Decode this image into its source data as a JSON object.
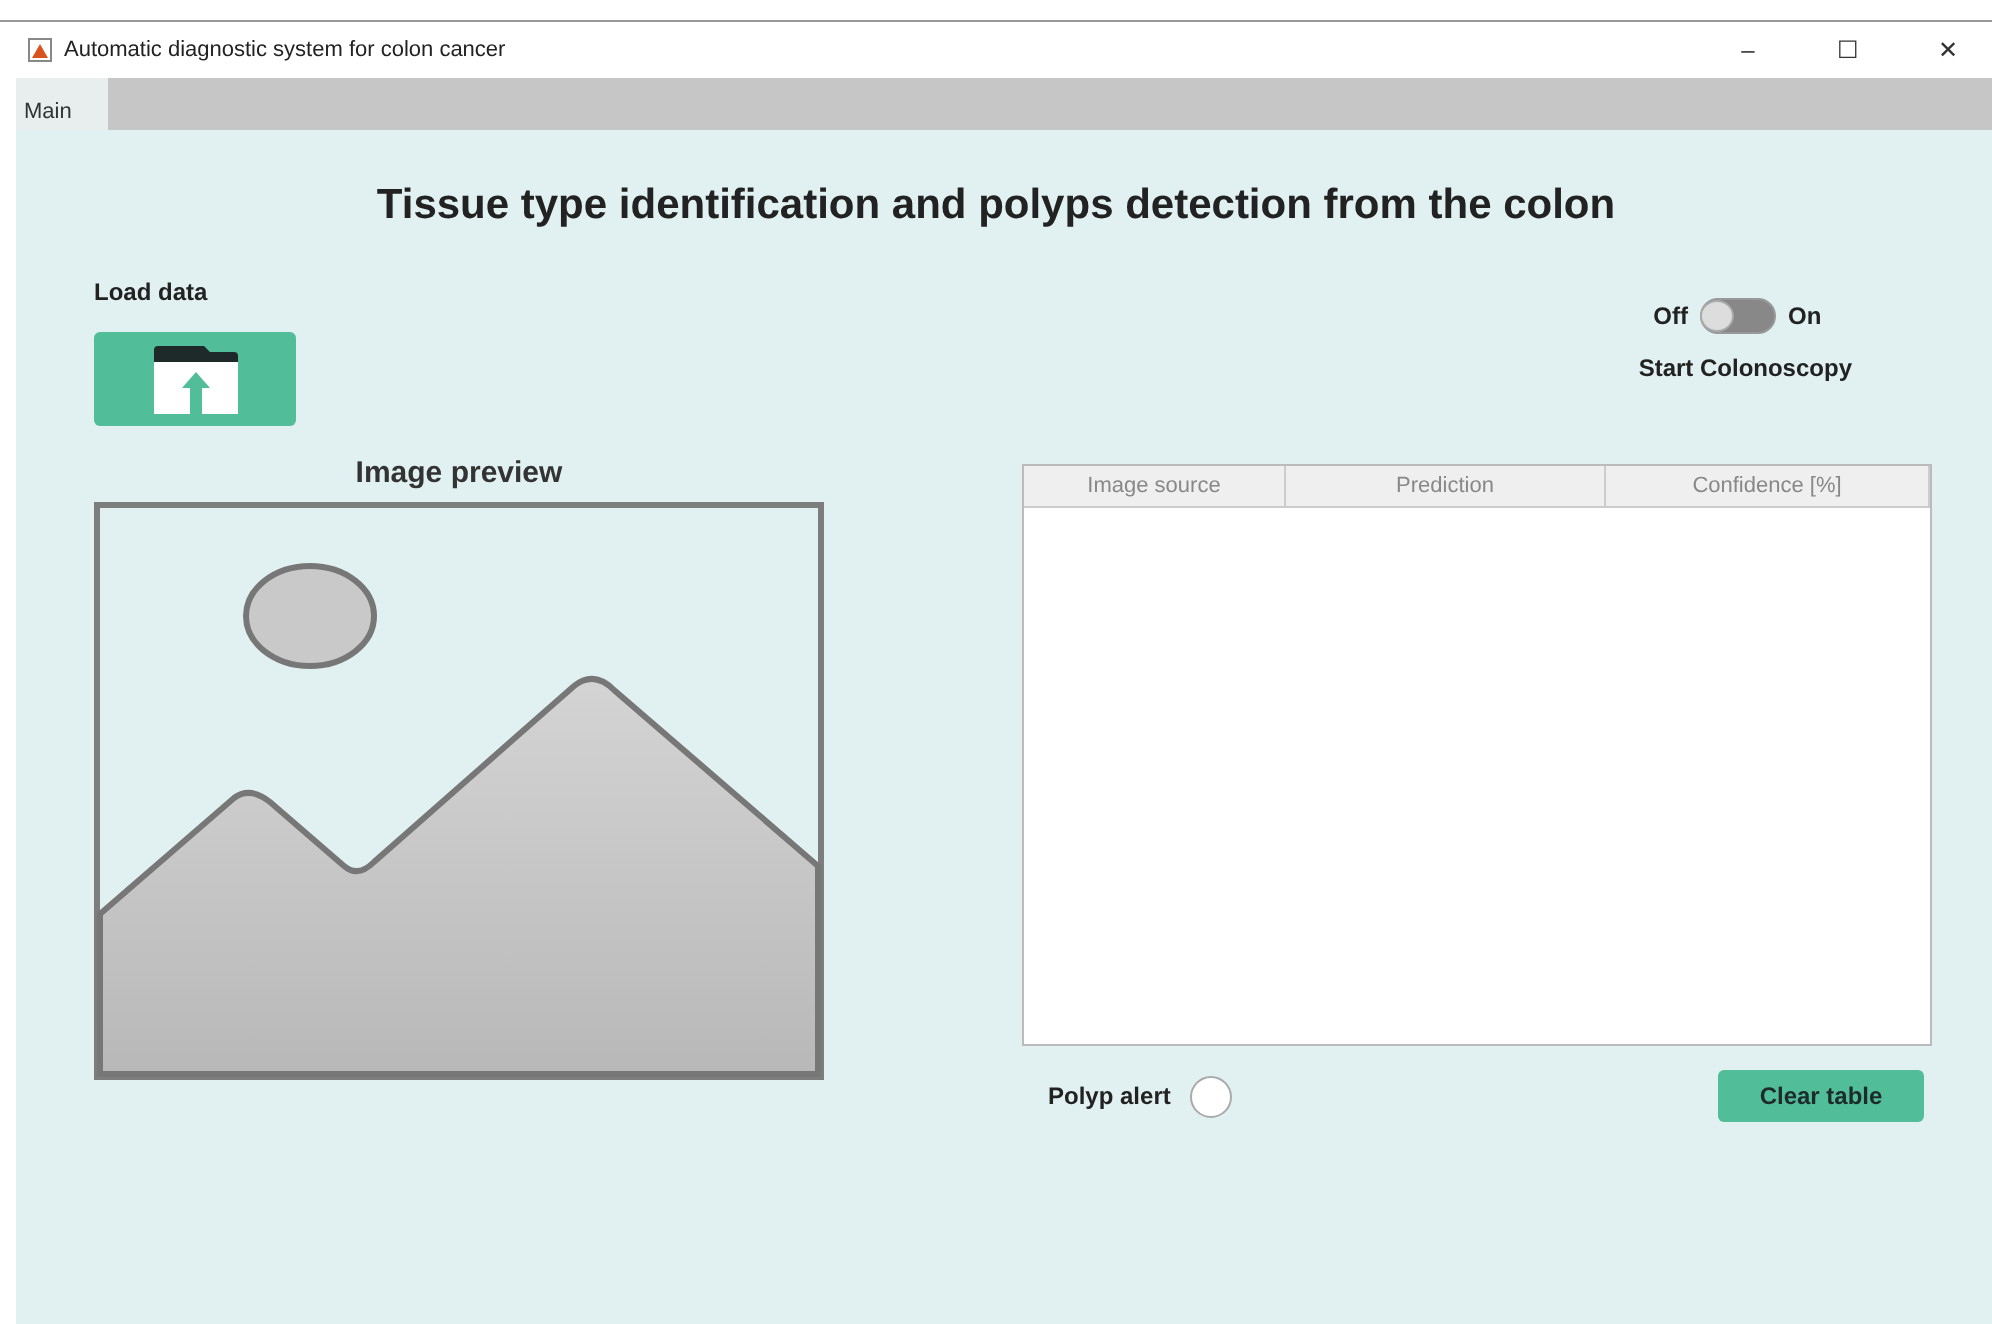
{
  "window": {
    "title": "Automatic diagnostic system for colon cancer",
    "controls": [
      "–",
      "☐",
      "✕"
    ]
  },
  "tabs": [
    {
      "label": "Main",
      "selected": true
    }
  ],
  "heading": "Tissue type identification and polyps detection from the colon",
  "load": {
    "label": "Load data"
  },
  "preview": {
    "label": "Image preview"
  },
  "colonoscopy": {
    "off_label": "Off",
    "on_label": "On",
    "on": false,
    "label": "Start Colonoscopy"
  },
  "table": {
    "columns": [
      "Image source",
      "Prediction",
      "Confidence [%]"
    ]
  },
  "polyp_alert": {
    "label": "Polyp alert",
    "on": false
  },
  "clear_button": "Clear table"
}
